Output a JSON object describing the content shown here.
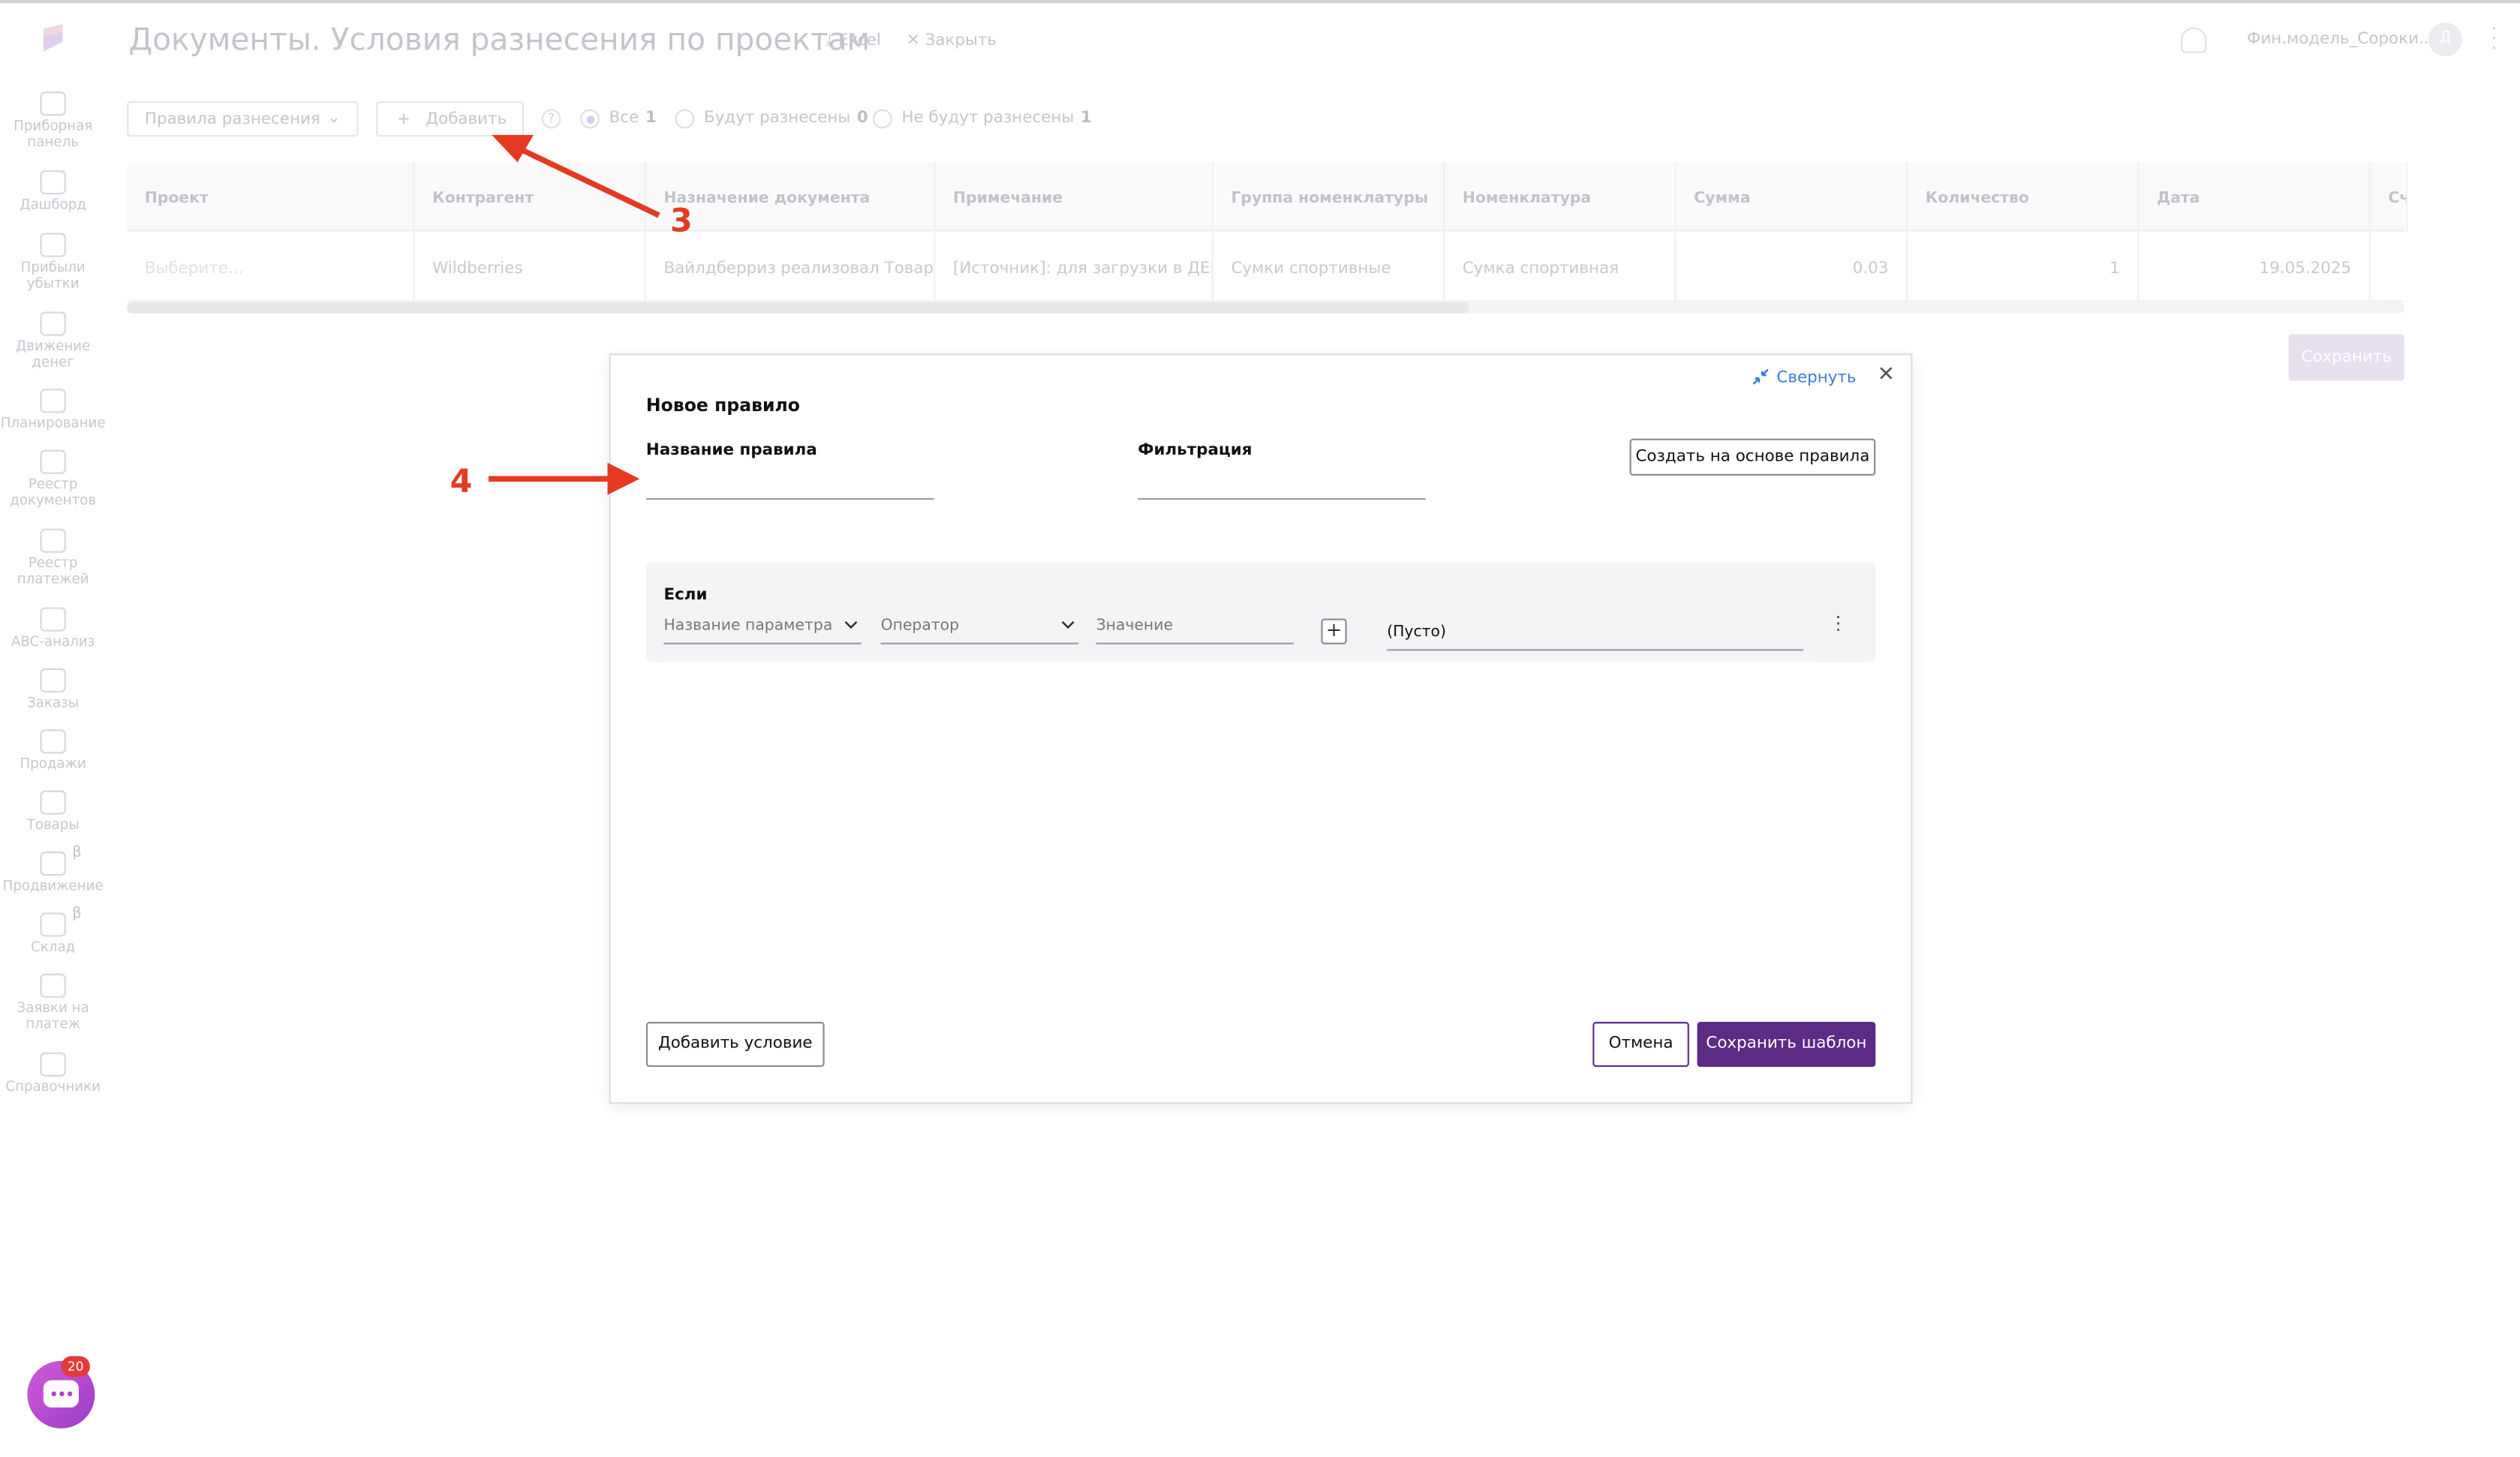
{
  "header": {
    "title": "Документы. Условия разнесения по проектам",
    "excel_label": "Excel",
    "close_label": "Закрыть",
    "user_name": "Фин.модель_Сороки...",
    "avatar_letter": "Д"
  },
  "sidebar": {
    "items": [
      {
        "label": "Приборная панель",
        "icon": "dashboard-icon"
      },
      {
        "label": "Дашборд",
        "icon": "pie-chart-icon"
      },
      {
        "label": "Прибыли убытки",
        "icon": "bar-chart-icon"
      },
      {
        "label": "Движение денег",
        "icon": "money-flow-icon"
      },
      {
        "label": "Планирование",
        "icon": "target-icon"
      },
      {
        "label": "Реестр документов",
        "icon": "documents-icon"
      },
      {
        "label": "Реестр платежей",
        "icon": "wallet-icon"
      },
      {
        "label": "ABC-анализ",
        "icon": "abc-icon"
      },
      {
        "label": "Заказы",
        "icon": "clipboard-icon"
      },
      {
        "label": "Продажи",
        "icon": "dollar-icon"
      },
      {
        "label": "Товары",
        "icon": "boxes-icon"
      },
      {
        "label": "Продвижение",
        "icon": "megaphone-icon",
        "badge": "β"
      },
      {
        "label": "Склад",
        "icon": "warehouse-icon",
        "badge": "β"
      },
      {
        "label": "Заявки на платеж",
        "icon": "request-icon"
      },
      {
        "label": "Справочники",
        "icon": "folder-icon"
      }
    ]
  },
  "toolbar": {
    "select_label": "Правила разнесения",
    "add_label": "Добавить",
    "help_glyph": "?",
    "filters": [
      {
        "label": "Все",
        "count": "1",
        "selected": true
      },
      {
        "label": "Будут разнесены",
        "count": "0",
        "selected": false
      },
      {
        "label": "Не будут разнесены",
        "count": "1",
        "selected": false
      }
    ]
  },
  "table": {
    "columns": [
      "Проект",
      "Контрагент",
      "Назначение документа",
      "Примечание",
      "Группа номенклатуры",
      "Номенклатура",
      "Сумма",
      "Количество",
      "Дата",
      "Сч"
    ],
    "row": {
      "project_placeholder": "Выберите...",
      "counterparty": "Wildberries",
      "purpose": "Вайлдберриз реализовал Товар (I",
      "note": "[Источник]: для загрузки в ДЕМО",
      "group": "Сумки спортивные",
      "item": "Сумка спортивная",
      "sum": "0.03",
      "qty": "1",
      "date": "19.05.2025"
    },
    "save_label": "Сохранить"
  },
  "modal": {
    "title": "Новое правило",
    "collapse_label": "Свернуть",
    "close_glyph": "✕",
    "rule_name_label": "Название правила",
    "rule_name_value": "",
    "filter_label": "Фильтрация",
    "filter_value": "",
    "create_from_rule_label": "Создать на основе правила",
    "condition": {
      "title": "Если",
      "param_placeholder": "Название параметра",
      "operator_placeholder": "Оператор",
      "value_placeholder": "Значение",
      "plus_glyph": "+",
      "value_text": "(Пусто)"
    },
    "add_condition_label": "Добавить условие",
    "cancel_label": "Отмена",
    "save_template_label": "Сохранить шаблон"
  },
  "annotations": {
    "step3": "3",
    "step4": "4",
    "color": "#e53a22"
  },
  "chat": {
    "badge": "20",
    "color": "#b040c8"
  },
  "colors": {
    "primary": "#5b2b86",
    "link": "#3b7dd8"
  }
}
